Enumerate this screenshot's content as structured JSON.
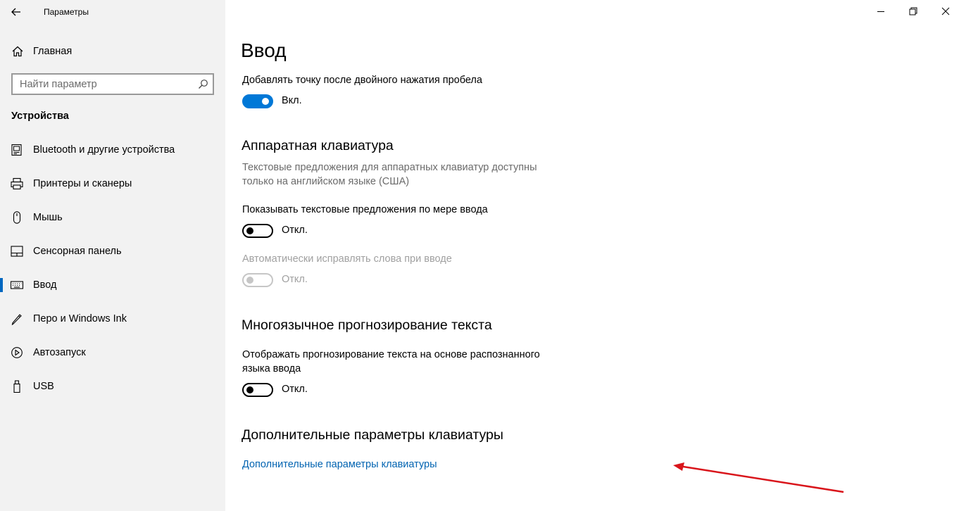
{
  "window": {
    "title": "Параметры",
    "controls": {
      "minimize_icon": "minimize-icon",
      "restore_icon": "restore-icon",
      "close_icon": "close-icon"
    }
  },
  "sidebar": {
    "home": {
      "label": "Главная",
      "icon": "home-icon"
    },
    "search": {
      "placeholder": "Найти параметр",
      "icon": "search-icon"
    },
    "section": "Устройства",
    "items": [
      {
        "label": "Bluetooth и другие устройства",
        "icon": "bluetooth-devices-icon",
        "active": false
      },
      {
        "label": "Принтеры и сканеры",
        "icon": "printer-icon",
        "active": false
      },
      {
        "label": "Мышь",
        "icon": "mouse-icon",
        "active": false
      },
      {
        "label": "Сенсорная панель",
        "icon": "touchpad-icon",
        "active": false
      },
      {
        "label": "Ввод",
        "icon": "keyboard-icon",
        "active": true
      },
      {
        "label": "Перо и Windows Ink",
        "icon": "pen-icon",
        "active": false
      },
      {
        "label": "Автозапуск",
        "icon": "autoplay-icon",
        "active": false
      },
      {
        "label": "USB",
        "icon": "usb-icon",
        "active": false
      }
    ]
  },
  "main": {
    "title": "Ввод",
    "double_space": {
      "label": "Добавлять точку после двойного нажатия пробела",
      "state": "Вкл.",
      "on": true
    },
    "hardware_keyboard": {
      "heading": "Аппаратная клавиатура",
      "description_line1": "Текстовые предложения для аппаратных клавиатур доступны",
      "description_line2": "только на английском языке (США)",
      "show_suggestions": {
        "label": "Показывать текстовые предложения по мере ввода",
        "state": "Откл.",
        "on": false
      },
      "autocorrect": {
        "label": "Автоматически исправлять слова при вводе",
        "state": "Откл.",
        "on": false,
        "disabled": true
      }
    },
    "multilingual": {
      "heading": "Многоязычное прогнозирование текста",
      "label_line1": "Отображать прогнозирование текста на основе распознанного",
      "label_line2": "языка ввода",
      "state": "Откл.",
      "on": false
    },
    "advanced": {
      "heading": "Дополнительные параметры клавиатуры",
      "link": "Дополнительные параметры клавиатуры"
    }
  },
  "colors": {
    "accent": "#0078d7",
    "link": "#0063b1",
    "sidebar_bg": "#f2f2f2",
    "annotation_arrow": "#d9151b"
  }
}
